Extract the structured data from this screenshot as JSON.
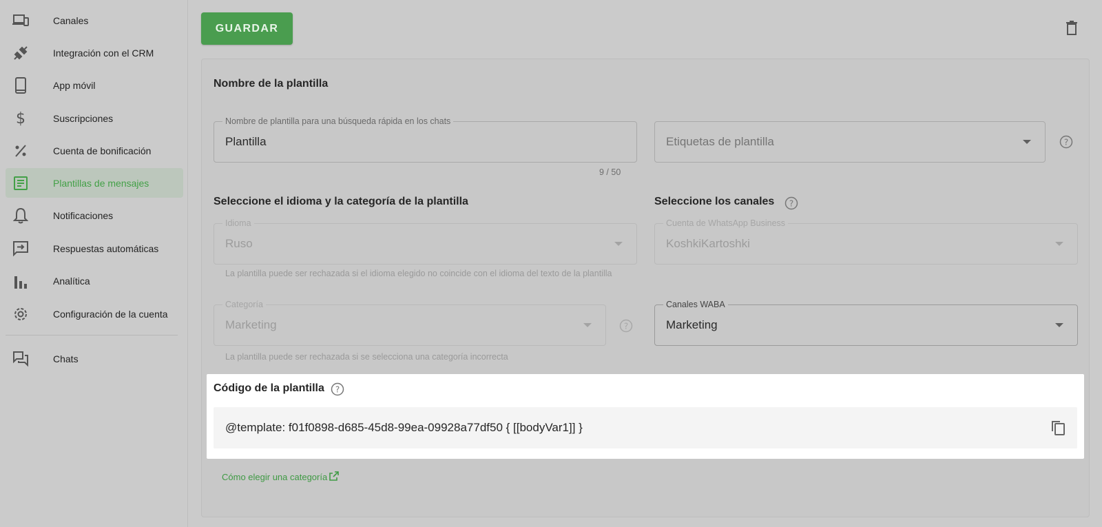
{
  "sidebar": {
    "items": [
      {
        "label": "Canales",
        "icon": "devices-icon"
      },
      {
        "label": "Integración con el CRM",
        "icon": "plug-icon"
      },
      {
        "label": "App móvil",
        "icon": "smartphone-icon"
      },
      {
        "label": "Suscripciones",
        "icon": "dollar-icon"
      },
      {
        "label": "Cuenta de bonificación",
        "icon": "percent-icon"
      },
      {
        "label": "Plantillas de mensajes",
        "icon": "document-icon",
        "active": true
      },
      {
        "label": "Notificaciones",
        "icon": "bell-icon"
      },
      {
        "label": "Respuestas automáticas",
        "icon": "auto-reply-icon"
      },
      {
        "label": "Analítica",
        "icon": "bar-chart-icon"
      },
      {
        "label": "Configuración de la cuenta",
        "icon": "gear-icon"
      },
      {
        "label": "Chats",
        "icon": "chats-icon"
      }
    ]
  },
  "toolbar": {
    "save_label": "GUARDAR"
  },
  "form": {
    "name_section_title": "Nombre de la plantilla",
    "name_field": {
      "label": "Nombre de plantilla para una búsqueda rápida en los chats",
      "value": "Plantilla",
      "counter": "9 / 50"
    },
    "tags_field": {
      "placeholder": "Etiquetas de plantilla"
    },
    "language_section_title": "Seleccione el idioma y la categoría de la plantilla",
    "language_field": {
      "label": "Idioma",
      "value": "Ruso",
      "helper": "La plantilla puede ser rechazada si el idioma elegido no coincide con el idioma del texto de la plantilla"
    },
    "category_field": {
      "label": "Categoría",
      "value": "Marketing",
      "helper": "La plantilla puede ser rechazada si se selecciona una categoría incorrecta"
    },
    "channels_section_title": "Seleccione los canales",
    "whatsapp_field": {
      "label": "Cuenta de WhatsApp Business",
      "value": "KoshkiKartoshki"
    },
    "waba_field": {
      "label": "Canales WABA",
      "value": "Marketing"
    },
    "code_section_title": "Código de la plantilla",
    "code_value": "@template: f01f0898-d685-45d8-99ea-09928a77df50 { [[bodyVar1]] }",
    "category_link": "Cómo elegir una categoría"
  },
  "colors": {
    "accent": "#4a9d4f",
    "link": "#3f9a44",
    "active_bg": "#bcc7bc"
  }
}
